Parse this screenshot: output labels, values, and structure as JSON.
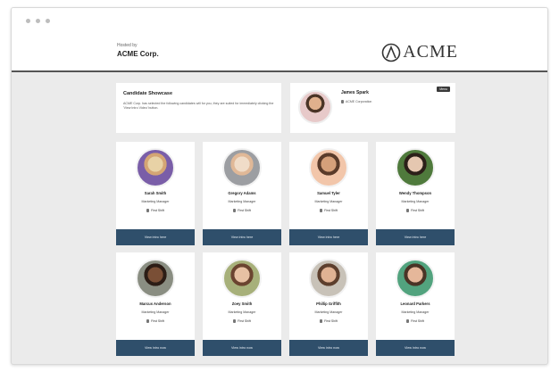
{
  "header": {
    "sponsor_label": "Hosted by",
    "sponsor_name": "ACME Corp.",
    "logo_text": "ACME"
  },
  "intro": {
    "title": "Candidate Showcase",
    "text": "ACME Corp. has selected the following candidates will for you, they are suited for immediately clicking the 'View Intro Video' button."
  },
  "recruiter": {
    "name": "James Spark",
    "subtitle": "ACME Corporation",
    "menu_label": "Menu"
  },
  "candidates": [
    {
      "name": "Sarah Smith",
      "role": "Marketing Manager",
      "shift": "First Shift",
      "cta": "View intro here",
      "colors": [
        "#e8d2a6",
        "#d4a574",
        "#7a5ea8"
      ]
    },
    {
      "name": "Gregory Adams",
      "role": "Marketing Manager",
      "shift": "First Shift",
      "cta": "View intro here",
      "colors": [
        "#f0dcc8",
        "#e0b897",
        "#9c9ea2"
      ]
    },
    {
      "name": "Samuel Tyler",
      "role": "Marketing Manager",
      "shift": "First Shift",
      "cta": "View intro here",
      "colors": [
        "#d5a07a",
        "#5a3b2a",
        "#f2c6aa"
      ]
    },
    {
      "name": "Wendy Thompson",
      "role": "Marketing Manager",
      "shift": "First Shift",
      "cta": "View intro here",
      "colors": [
        "#e5c7b0",
        "#2c2019",
        "#4f7a3c"
      ]
    },
    {
      "name": "Marcus Anderson",
      "role": "Marketing Manager",
      "shift": "First Shift",
      "cta": "View intro now",
      "colors": [
        "#7a4f36",
        "#2c1d16",
        "#8a8e82"
      ]
    },
    {
      "name": "Zoey Smith",
      "role": "Marketing Manager",
      "shift": "First Shift",
      "cta": "View intro now",
      "colors": [
        "#e7c1a3",
        "#6b4430",
        "#a7b07a"
      ]
    },
    {
      "name": "Phillip Griffith",
      "role": "Marketing Manager",
      "shift": "First Shift",
      "cta": "View intro now",
      "colors": [
        "#e0b293",
        "#5d3f2d",
        "#c8c2b8"
      ]
    },
    {
      "name": "Leonard Parkers",
      "role": "Marketing Manager",
      "shift": "First Shift",
      "cta": "View intro now",
      "colors": [
        "#e5b79a",
        "#4a3426",
        "#52a37e"
      ]
    }
  ]
}
